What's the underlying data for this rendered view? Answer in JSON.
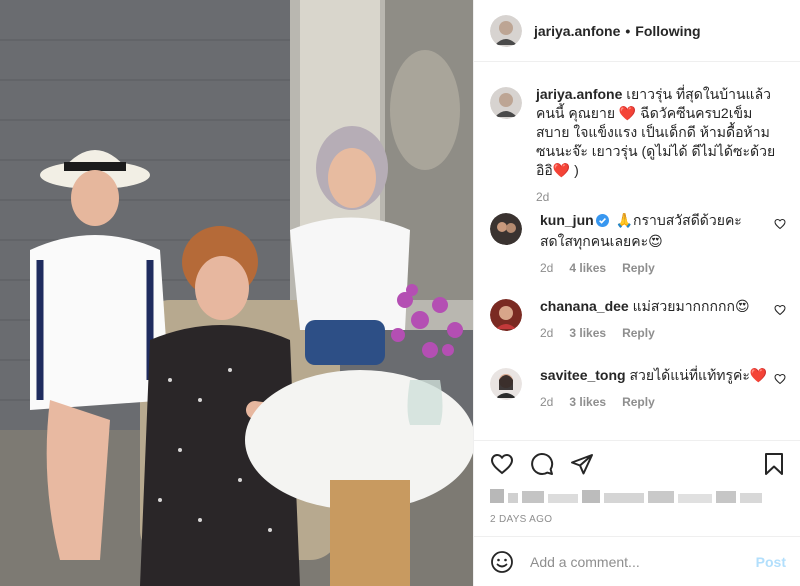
{
  "header": {
    "username": "jariya.anfone",
    "separator": "•",
    "follow_status": "Following"
  },
  "caption": {
    "username": "jariya.anfone",
    "text": "เยาวรุ่น ที่สุดในบ้านแล้วคนนี้ คุณยาย ❤️ ฉีดวัคซีนครบ2เข็มสบาย ใจแข็งแรง เป็นเด็กดี ห้ามดื้อห้ามซนนะจ๊ะ เยาวรุ่น (ดูไม่ได้ ดีไม่ได้ซะด้วย อิอิ❤️ )",
    "time": "2d"
  },
  "comments": [
    {
      "username": "kun_jun",
      "verified": true,
      "text": "🙏กราบสวัสดีด้วยคะ สดใสทุกคนเลยคะ😍",
      "time": "2d",
      "likes": "4 likes",
      "reply": "Reply"
    },
    {
      "username": "chanana_dee",
      "verified": false,
      "text": "แม่สวยมากกกกก😍",
      "time": "2d",
      "likes": "3 likes",
      "reply": "Reply"
    },
    {
      "username": "savitee_tong",
      "verified": false,
      "text": "สวยได้แน่ที่แท้ทรูค่ะ❤️",
      "time": "2d",
      "likes": "3 likes",
      "reply": "Reply"
    }
  ],
  "actions": {
    "icons": [
      "heart-icon",
      "comment-icon",
      "share-icon",
      "bookmark-icon"
    ],
    "post_date": "2 DAYS AGO"
  },
  "add_comment": {
    "placeholder": "Add a comment...",
    "post_label": "Post"
  },
  "colors": {
    "text": "#262626",
    "secondary": "#8e8e8e",
    "divider": "#efefef",
    "post_disabled": "#b2dffc",
    "verified": "#3897f0",
    "like_heart": "#ed4956"
  }
}
